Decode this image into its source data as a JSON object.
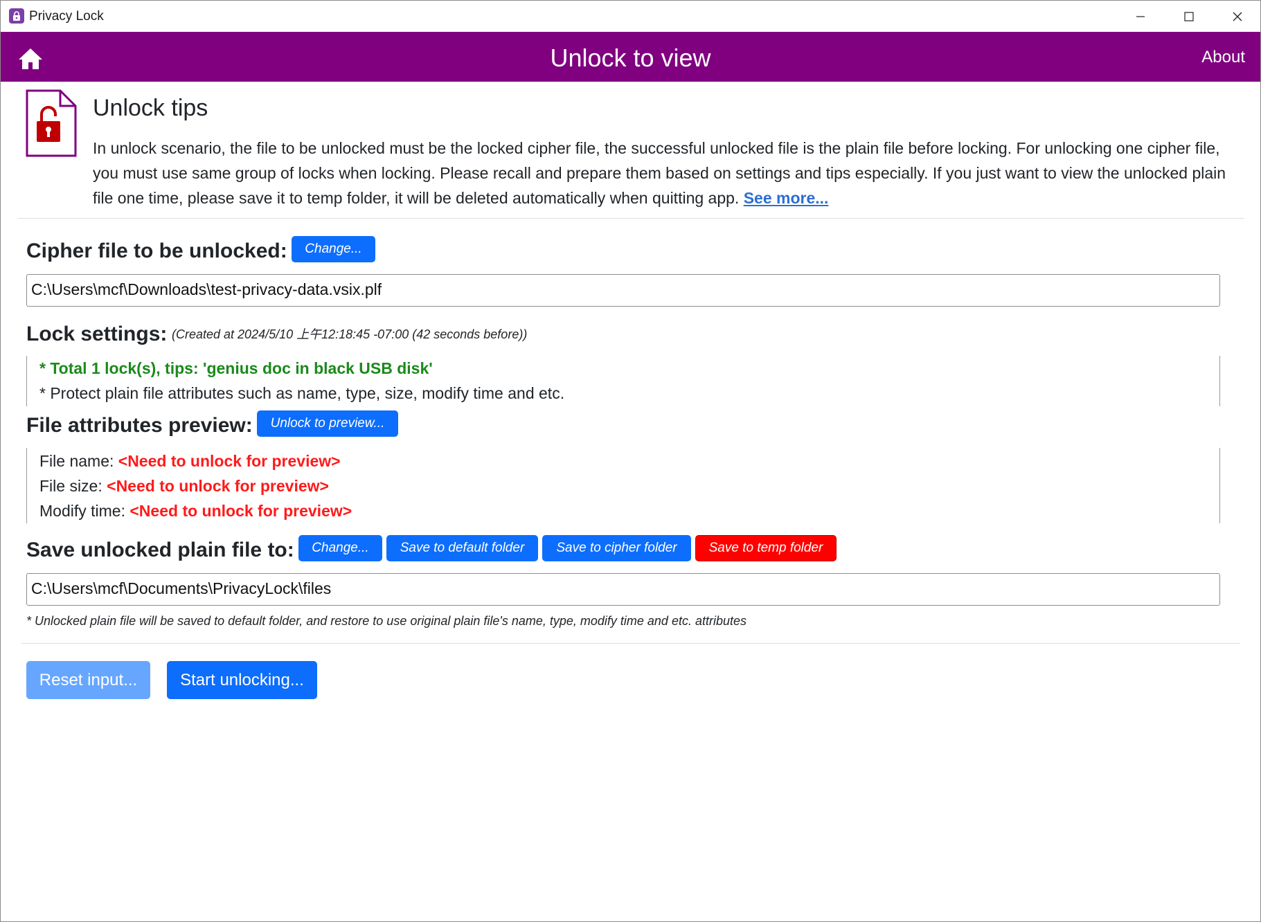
{
  "window": {
    "title": "Privacy Lock"
  },
  "header": {
    "title": "Unlock to view",
    "about": "About"
  },
  "tips": {
    "title": "Unlock tips",
    "text": "In unlock scenario, the file to be unlocked must be the locked cipher file, the successful unlocked file is the plain file before locking. For unlocking one cipher file, you must use same group of locks when locking. Please recall and prepare them based on settings and tips especially. If you just want to view the unlocked plain file one time, please save it to temp folder, it will be deleted automatically when quitting app.",
    "see_more": "See more..."
  },
  "cipher": {
    "label": "Cipher file to be unlocked:",
    "change_button": "Change...",
    "path": "C:\\Users\\mcf\\Downloads\\test-privacy-data.vsix.plf"
  },
  "lock_settings": {
    "label": "Lock settings:",
    "created": "(Created at 2024/5/10 上午12:18:45 -07:00 (42 seconds before))",
    "total_locks": "* Total 1 lock(s), tips: 'genius doc in black USB disk'",
    "protect_note": "* Protect plain file attributes such as name, type, size, modify time and etc."
  },
  "preview": {
    "label": "File attributes preview:",
    "unlock_button": "Unlock to preview...",
    "rows": [
      {
        "key": "File name:",
        "value": "<Need to unlock for preview>"
      },
      {
        "key": "File size:",
        "value": "<Need to unlock for preview>"
      },
      {
        "key": "Modify time:",
        "value": "<Need to unlock for preview>"
      }
    ]
  },
  "save": {
    "label": "Save unlocked plain file to:",
    "buttons": {
      "change": "Change...",
      "default_folder": "Save to default folder",
      "cipher_folder": "Save to cipher folder",
      "temp_folder": "Save to temp folder"
    },
    "path": "C:\\Users\\mcf\\Documents\\PrivacyLock\\files",
    "note": "* Unlocked plain file will be saved to default folder, and restore to use original plain file's name, type, modify time and etc. attributes"
  },
  "actions": {
    "reset": "Reset input...",
    "start": "Start unlocking..."
  },
  "colors": {
    "header": "#800080",
    "primary": "#0d6efd",
    "danger": "#ff0000",
    "success": "#1a8a1a"
  },
  "icons": {
    "home": "home-icon",
    "tips": "unlock-file-icon",
    "minimize": "minimize-icon",
    "maximize": "maximize-icon",
    "close": "close-icon"
  }
}
